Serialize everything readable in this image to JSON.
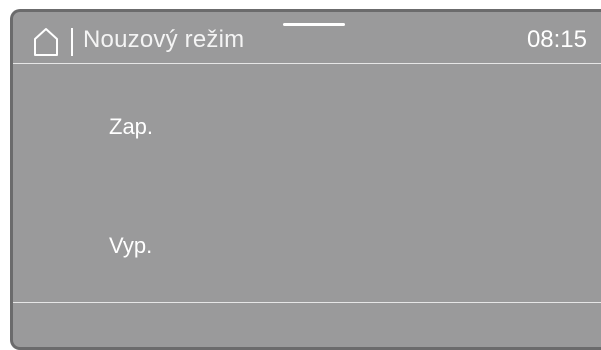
{
  "header": {
    "title": "Nouzový režim",
    "time": "08:15",
    "home_icon": "home-icon"
  },
  "options": [
    {
      "label": "Zap."
    },
    {
      "label": "Vyp."
    }
  ],
  "colors": {
    "screen_background": "#9a9a9b",
    "screen_border": "#6b6b6c",
    "text": "#ffffff"
  }
}
